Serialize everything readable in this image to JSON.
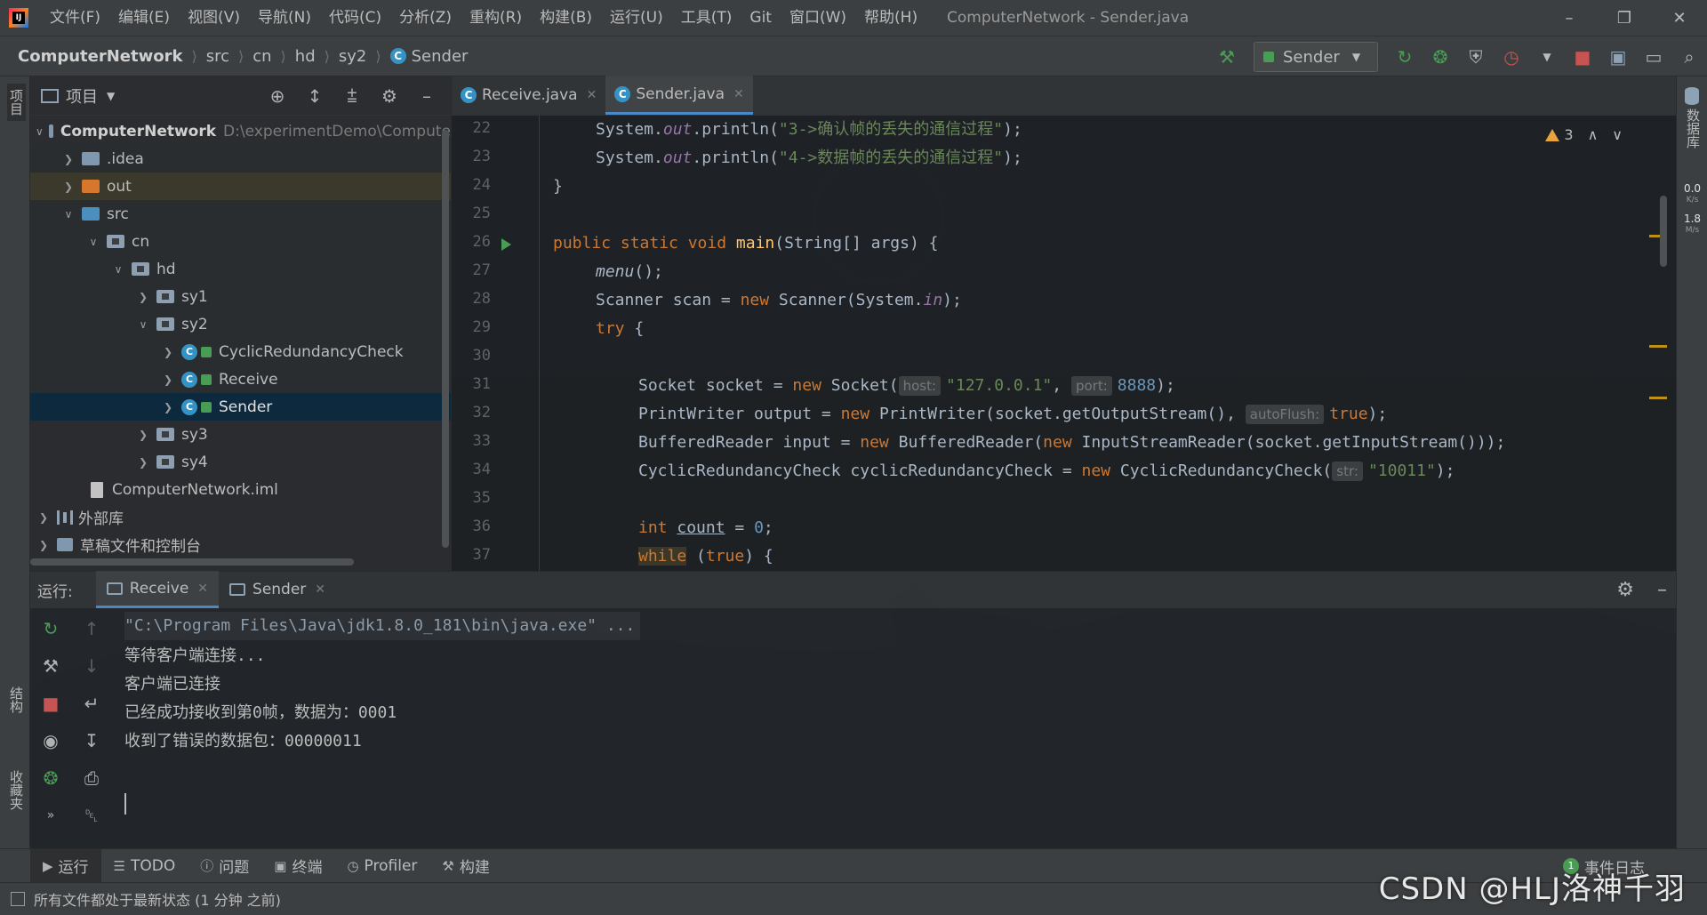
{
  "app": {
    "logo_text": "IJ",
    "window_title": "ComputerNetwork - Sender.java",
    "menu": [
      "文件(F)",
      "编辑(E)",
      "视图(V)",
      "导航(N)",
      "代码(C)",
      "分析(Z)",
      "重构(R)",
      "构建(B)",
      "运行(U)",
      "工具(T)",
      "Git",
      "窗口(W)",
      "帮助(H)"
    ]
  },
  "navbar": {
    "breadcrumb": [
      "ComputerNetwork",
      "src",
      "cn",
      "hd",
      "sy2",
      "Sender"
    ],
    "run_config": "Sender"
  },
  "stripes": {
    "left_top": "项目",
    "left_structure": "结构",
    "left_favorites": "收藏夹",
    "right_db": "数据库",
    "net_down": "0.0",
    "net_down_unit": "K/s",
    "net_up": "1.8",
    "net_up_unit": "M/s"
  },
  "project": {
    "title": "项目",
    "tree": [
      {
        "label": "ComputerNetwork",
        "path": "D:\\experimentDemo\\Compute",
        "level": 0
      },
      {
        "label": ".idea",
        "level": 1
      },
      {
        "label": "out",
        "level": 1
      },
      {
        "label": "src",
        "level": 1
      },
      {
        "label": "cn",
        "level": 2
      },
      {
        "label": "hd",
        "level": 3
      },
      {
        "label": "sy1",
        "level": 4
      },
      {
        "label": "sy2",
        "level": 4
      },
      {
        "label": "CyclicRedundancyCheck",
        "level": 5
      },
      {
        "label": "Receive",
        "level": 5
      },
      {
        "label": "Sender",
        "level": 5
      },
      {
        "label": "sy3",
        "level": 4
      },
      {
        "label": "sy4",
        "level": 4
      },
      {
        "label": "ComputerNetwork.iml",
        "level": 1
      },
      {
        "label": "外部库",
        "level": 0
      },
      {
        "label": "草稿文件和控制台",
        "level": 0
      }
    ]
  },
  "editor": {
    "tabs": [
      "Receive.java",
      "Sender.java"
    ],
    "active_tab": "Sender.java",
    "warning_count": "3",
    "line_numbers": [
      "22",
      "23",
      "24",
      "25",
      "26",
      "27",
      "28",
      "29",
      "30",
      "31",
      "32",
      "33",
      "34",
      "35",
      "36",
      "37"
    ],
    "hints": {
      "host": "host:",
      "port": "port:",
      "autoflush": "autoFlush:",
      "str": "str:"
    },
    "strings": {
      "s22": "\"3->确认帧的丢失的通信过程\"",
      "s23": "\"4->数据帧的丢失的通信过程\"",
      "ip": "\"127.0.0.1\"",
      "port": "8888",
      "poly": "\"10011\"",
      "zero": "0"
    }
  },
  "run": {
    "label": "运行:",
    "tabs": [
      "Receive",
      "Sender"
    ],
    "active_tab": "Receive",
    "console": [
      "\"C:\\Program Files\\Java\\jdk1.8.0_181\\bin\\java.exe\" ...",
      "等待客户端连接...",
      "客户端已连接",
      "已经成功接收到第0帧，数据为：0001",
      "收到了错误的数据包：00000011"
    ]
  },
  "toolwindows": {
    "run": "运行",
    "todo": "TODO",
    "problems": "问题",
    "terminal": "终端",
    "profiler": "Profiler",
    "build": "构建",
    "event_log": "事件日志",
    "event_count": "1"
  },
  "status": {
    "message": "所有文件都处于最新状态 (1 分钟 之前)",
    "watermark": "CSDN @HLJ洛神千羽"
  },
  "colors": {
    "accent": "#4a88c7",
    "keyword": "#cc7832",
    "string": "#6a8759",
    "number": "#6897bb",
    "function": "#ffc66d",
    "field": "#9876aa"
  }
}
